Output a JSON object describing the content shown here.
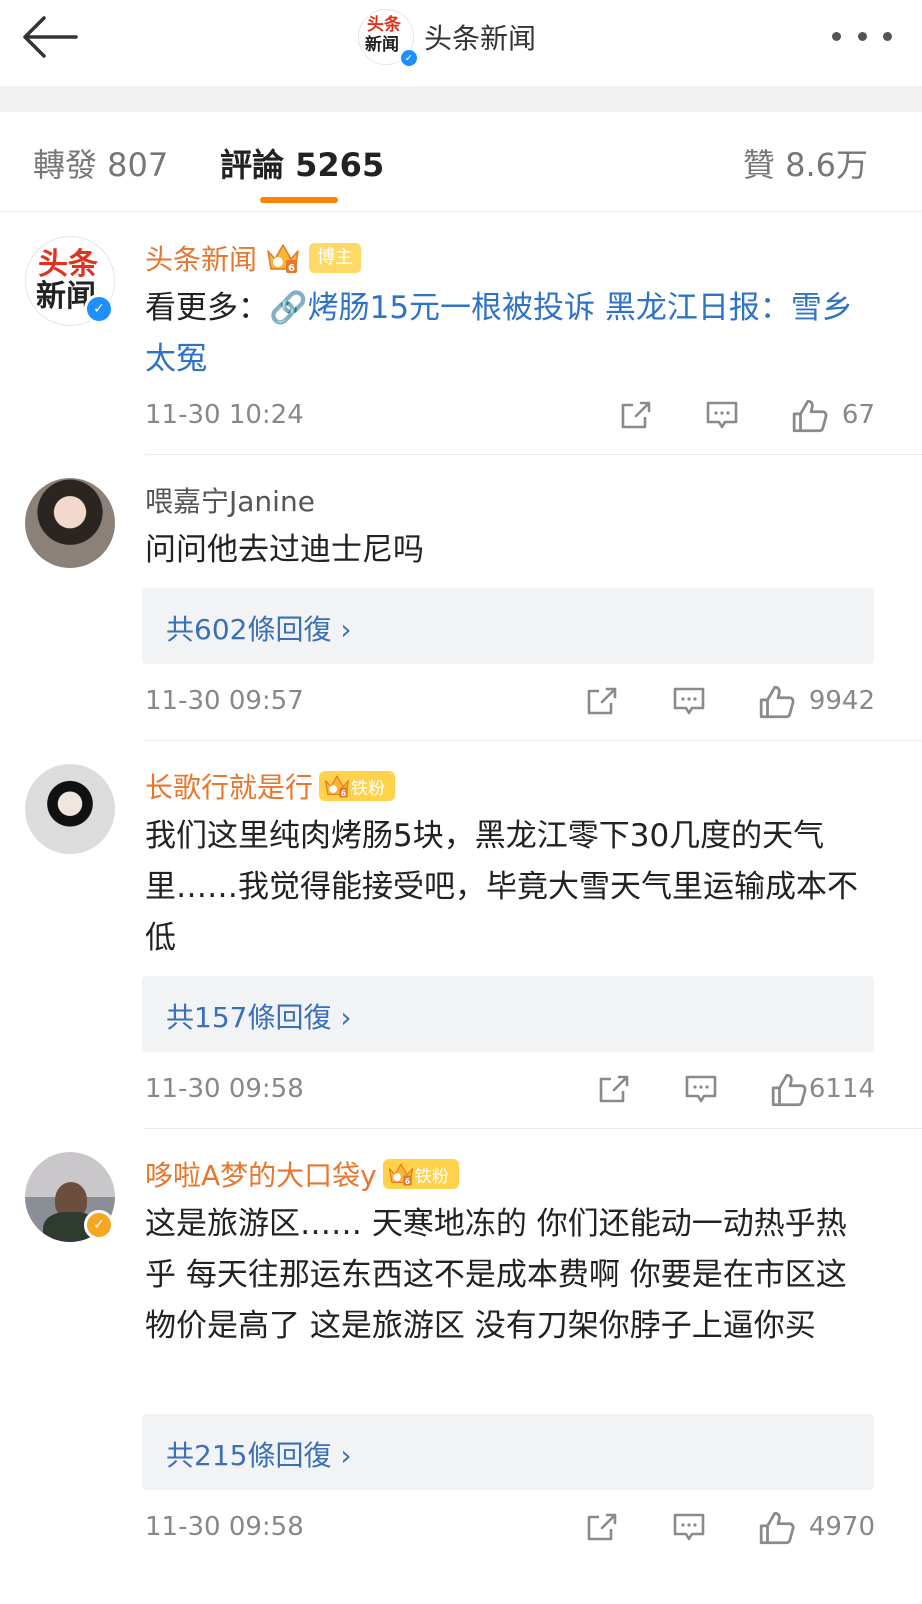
{
  "header": {
    "title": "头条新闻",
    "avatar_text_line1": "头条",
    "avatar_text_line2": "新闻"
  },
  "tabs": {
    "repost": "轉發 807",
    "comments": "評論 5265",
    "likes": "贊 8.6万"
  },
  "colors": {
    "accent": "#ff8200",
    "link": "#2e73c5",
    "vip_name": "#e8762c",
    "verified_blue": "#1e8fff",
    "verified_gold": "#f5a623"
  },
  "comments": [
    {
      "username": "头条新闻",
      "tag": "博主",
      "text_prefix": "看更多：",
      "link": "🔗烤肠15元一根被投诉 黑龙江日报：雪乡太冤",
      "time": "11-30 10:24",
      "likes": "67"
    },
    {
      "username": "喂嘉宁Janine",
      "text": "问问他去过迪士尼吗",
      "replies": "共602條回復 ›",
      "time": "11-30 09:57",
      "likes": "9942"
    },
    {
      "username": "长歌行就是行",
      "tag": "铁粉",
      "text": "我们这里纯肉烤肠5块，黑龙江零下30几度的天气里……我觉得能接受吧，毕竟大雪天气里运输成本不低",
      "replies": "共157條回復 ›",
      "time": "11-30 09:58",
      "likes": "6114"
    },
    {
      "username": "哆啦A梦的大口袋y",
      "tag": "铁粉",
      "text": "这是旅游区…… 天寒地冻的 你们还能动一动热乎热乎 每天往那运东西这不是成本费啊 你要是在市区这物价是高了 这是旅游区 没有刀架你脖子上逼你买",
      "replies": "共215條回復 ›",
      "time": "11-30 09:58",
      "likes": "4970"
    }
  ]
}
